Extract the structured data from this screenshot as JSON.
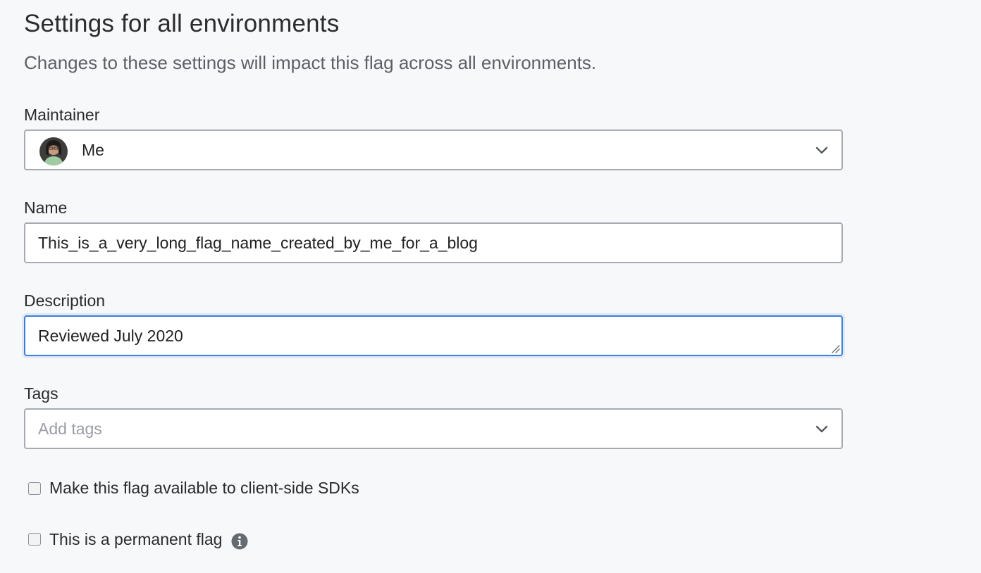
{
  "header": {
    "title": "Settings for all environments",
    "subtitle": "Changes to these settings will impact this flag across all environments."
  },
  "maintainer": {
    "label": "Maintainer",
    "value": "Me",
    "icon": "chevron-down-icon"
  },
  "name": {
    "label": "Name",
    "value": "This_is_a_very_long_flag_name_created_by_me_for_a_blog"
  },
  "description": {
    "label": "Description",
    "value": "Reviewed July 2020"
  },
  "tags": {
    "label": "Tags",
    "placeholder": "Add tags",
    "icon": "chevron-down-icon"
  },
  "checkboxes": {
    "client_side": {
      "label": "Make this flag available to client-side SDKs",
      "checked": false
    },
    "permanent": {
      "label": "This is a permanent flag",
      "checked": false,
      "icon": "info-icon"
    }
  },
  "colors": {
    "background": "#f7f8fa",
    "border": "#a7abb0",
    "focus": "#3b7fd9",
    "icon": "#646a70"
  }
}
